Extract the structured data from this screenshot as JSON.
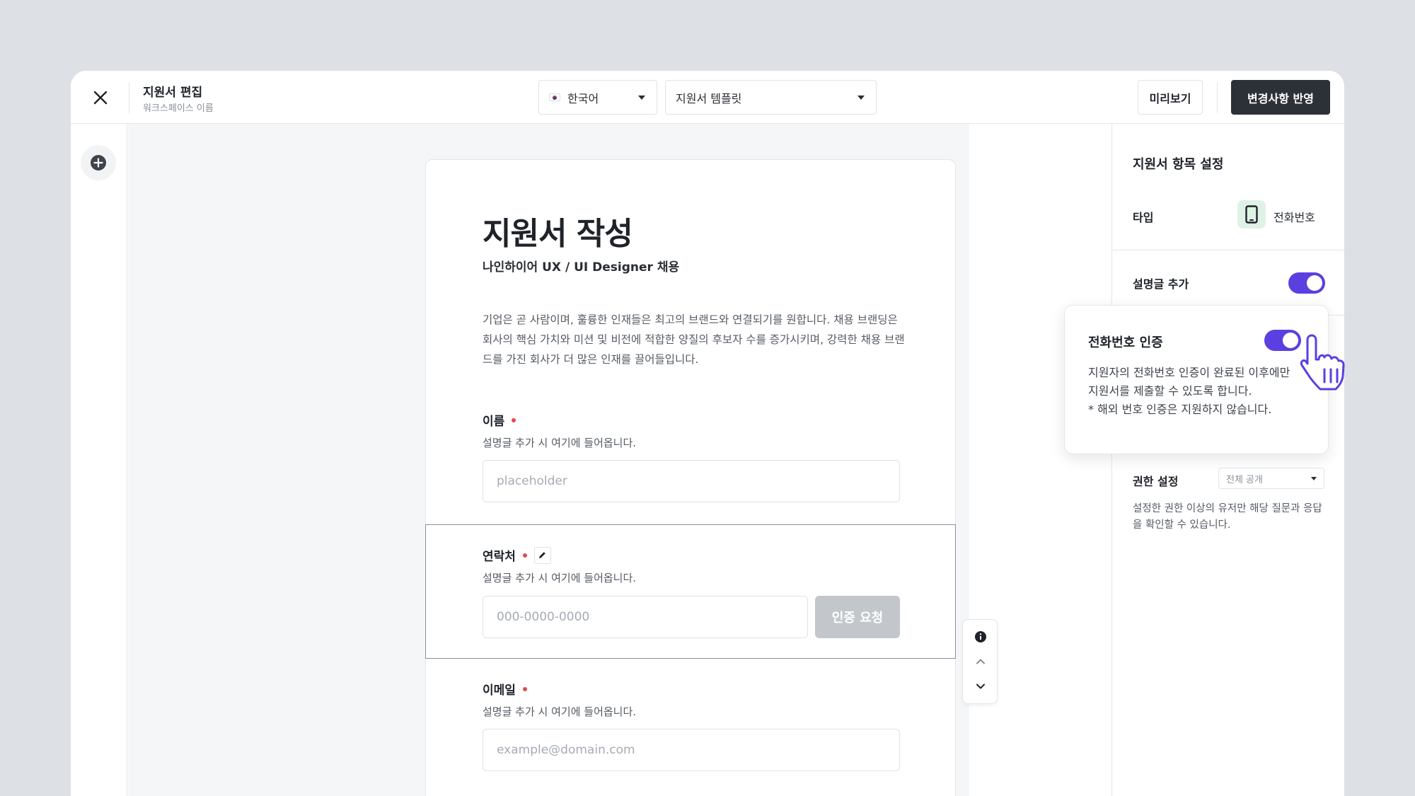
{
  "header": {
    "title": "지원서 편집",
    "subtitle": "워크스페이스 이름",
    "language": "한국어",
    "template": "지원서 템플릿",
    "preview_label": "미리보기",
    "apply_label": "변경사항 반영"
  },
  "form": {
    "title": "지원서 작성",
    "subtitle": "나인하이어 UX / UI Designer 채용",
    "description": "기업은 곧 사람이며, 훌륭한 인재들은 최고의 브랜드와 연결되기를 원합니다. 채용 브랜딩은 회사의 핵심 가치와 미션 및 비전에 적합한 양질의 후보자 수를 증가시키며, 강력한 채용 브랜드를 가진 회사가 더 많은 인재를 끌어들입니다.",
    "fields": {
      "name": {
        "label": "이름",
        "help": "설명글 추가 시 여기에 들어옵니다.",
        "placeholder": "placeholder"
      },
      "contact": {
        "label": "연락처",
        "help": "설명글 추가 시 여기에 들어옵니다.",
        "placeholder": "000-0000-0000",
        "verify_label": "인증 요청"
      },
      "email": {
        "label": "이메일",
        "help": "설명글 추가 시 여기에 들어옵니다.",
        "placeholder": "example@domain.com"
      }
    }
  },
  "panel": {
    "title": "지원서 항목 설정",
    "type_label": "타입",
    "type_value": "전화번호",
    "type_icon": "phone-icon",
    "description_toggle_label": "설명글 추가",
    "description_toggle_on": true,
    "permission_label": "권한 설정",
    "permission_value": "전체 공개",
    "permission_desc": "설정한 권한 이상의 유저만 해당 질문과 응답을 확인할 수 있습니다."
  },
  "popover": {
    "title": "전화번호 인증",
    "toggle_on": true,
    "lines": [
      "지원자의 전화번호 인증이 완료된 이후에만",
      "지원서를 제출할 수 있도록 합니다.",
      "* 해외 번호 인증은 지원하지 않습니다."
    ]
  },
  "colors": {
    "accent": "#5b3fe0",
    "dark_button": "#2c3138",
    "required": "#e5484d",
    "type_icon_bg": "#dff2e6"
  }
}
